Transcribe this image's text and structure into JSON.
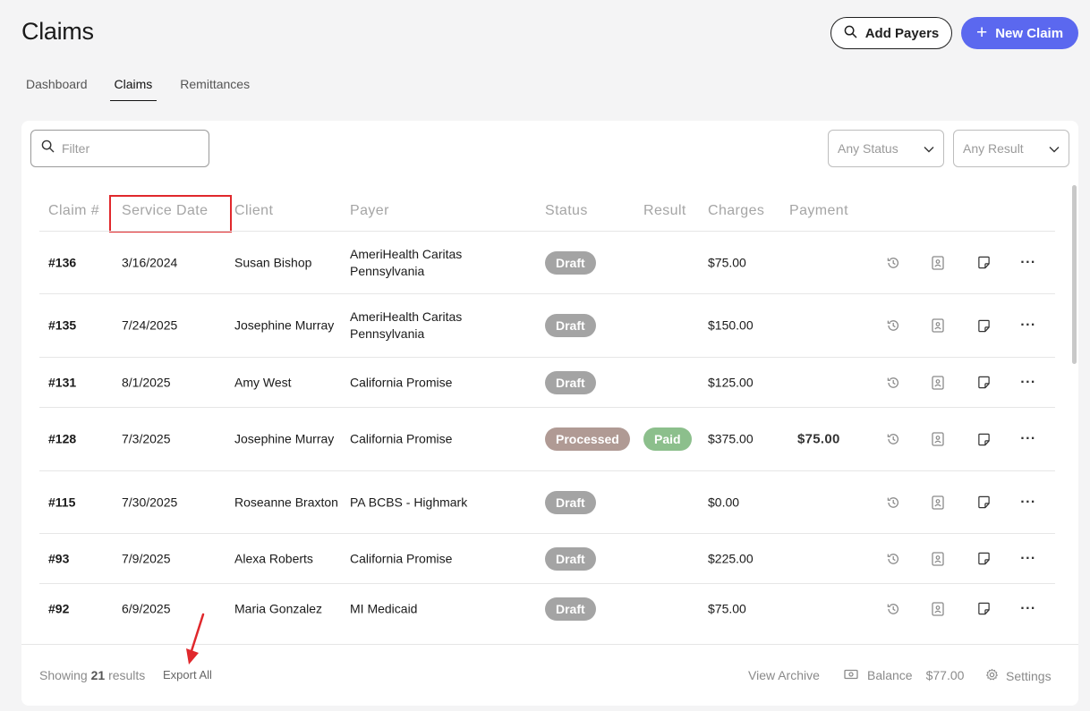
{
  "header": {
    "title": "Claims",
    "add_payers_label": "Add Payers",
    "new_claim_label": "New Claim",
    "accent": "#5b68ef"
  },
  "tabs": [
    {
      "label": "Dashboard",
      "active": false
    },
    {
      "label": "Claims",
      "active": true
    },
    {
      "label": "Remittances",
      "active": false
    }
  ],
  "filters": {
    "search_placeholder": "Filter",
    "status_value": "Any Status",
    "result_value": "Any Result"
  },
  "table": {
    "columns": [
      "Claim #",
      "Service Date",
      "Client",
      "Payer",
      "Status",
      "Result",
      "Charges",
      "Payment"
    ],
    "highlighted_column": "Service Date",
    "rows": [
      {
        "num": "#136",
        "date": "3/16/2024",
        "client": "Susan Bishop",
        "payer": "AmeriHealth Caritas Pennsylvania",
        "status": "Draft",
        "result": "",
        "charges": "$75.00",
        "payment": ""
      },
      {
        "num": "#135",
        "date": "7/24/2025",
        "client": "Josephine Murray",
        "payer": "AmeriHealth Caritas Pennsylvania",
        "status": "Draft",
        "result": "",
        "charges": "$150.00",
        "payment": ""
      },
      {
        "num": "#131",
        "date": "8/1/2025",
        "client": "Amy West",
        "payer": "California Promise",
        "status": "Draft",
        "result": "",
        "charges": "$125.00",
        "payment": ""
      },
      {
        "num": "#128",
        "date": "7/3/2025",
        "client": "Josephine Murray",
        "payer": "California Promise",
        "status": "Processed",
        "result": "Paid",
        "charges": "$375.00",
        "payment": "$75.00"
      },
      {
        "num": "#115",
        "date": "7/30/2025",
        "client": "Roseanne Braxton",
        "payer": "PA BCBS - Highmark",
        "status": "Draft",
        "result": "",
        "charges": "$0.00",
        "payment": ""
      },
      {
        "num": "#93",
        "date": "7/9/2025",
        "client": "Alexa Roberts",
        "payer": "California Promise",
        "status": "Draft",
        "result": "",
        "charges": "$225.00",
        "payment": ""
      },
      {
        "num": "#92",
        "date": "6/9/2025",
        "client": "Maria Gonzalez",
        "payer": "MI Medicaid",
        "status": "Draft",
        "result": "",
        "charges": "$75.00",
        "payment": ""
      }
    ],
    "row_icons": [
      "history-icon",
      "contact-card-icon",
      "note-icon",
      "more-icon"
    ],
    "more_glyph": "···"
  },
  "footer": {
    "showing_prefix": "Showing",
    "showing_count": "21",
    "showing_suffix": "results",
    "export_label": "Export All",
    "archive_label": "View Archive",
    "balance_label": "Balance",
    "balance_amount": "$77.00",
    "settings_label": "Settings"
  },
  "colors": {
    "draft": "#a4a4a4",
    "processed": "#b09a94",
    "paid": "#8cbf8c",
    "annotation": "#e0282c"
  }
}
